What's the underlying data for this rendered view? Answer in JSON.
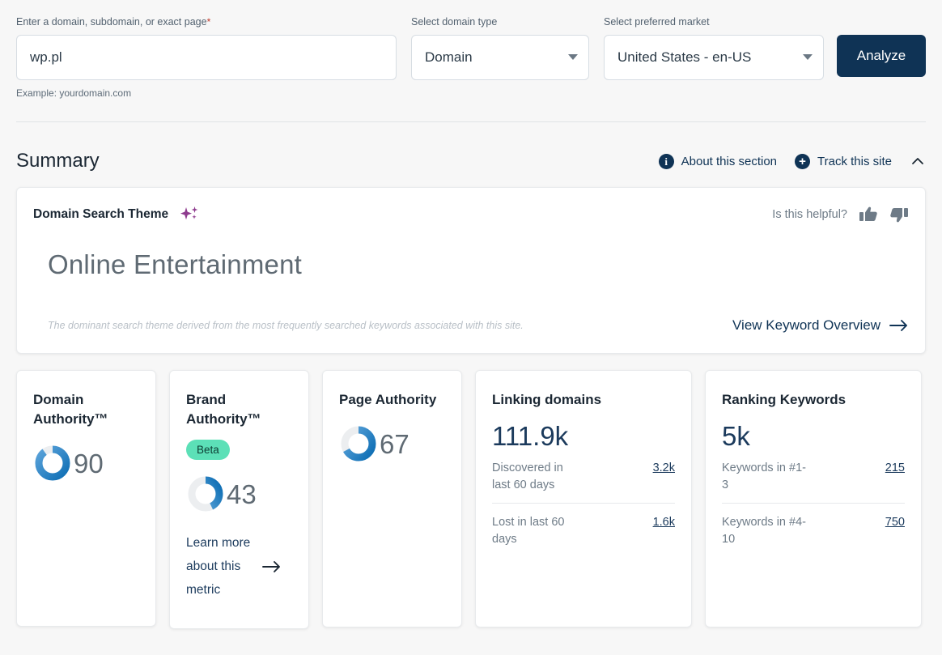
{
  "search": {
    "domain_label": "Enter a domain, subdomain, or exact page",
    "required_mark": "*",
    "domain_value": "wp.pl",
    "domain_placeholder": "yourdomain.com",
    "helper": "Example: yourdomain.com",
    "type_label": "Select domain type",
    "type_value": "Domain",
    "market_label": "Select preferred market",
    "market_value": "United States - en-US",
    "analyze_label": "Analyze"
  },
  "summary": {
    "title": "Summary",
    "about_label": "About this section",
    "track_label": "Track this site",
    "about_icon": "info-circle-icon",
    "track_icon": "plus-circle-icon",
    "collapse_icon": "chevron-up-icon"
  },
  "theme": {
    "kicker": "Domain Search Theme",
    "sparkle_icon": "ai-sparkle-icon",
    "helpful_question": "Is this helpful?",
    "thumbs_up_icon": "thumbs-up-icon",
    "thumbs_down_icon": "thumbs-down-icon",
    "title": "Online Entertainment",
    "note": "The dominant search theme derived from the most frequently searched keywords associated with this site.",
    "link_label": "View Keyword Overview",
    "link_arrow_icon": "arrow-right-icon"
  },
  "metrics": {
    "domain_authority": {
      "title": "Domain Authority™",
      "value": "90",
      "percent": 90
    },
    "brand_authority": {
      "title": "Brand Authority™",
      "badge": "Beta",
      "value": "43",
      "percent": 43,
      "learn_more": "Learn more about this metric",
      "learn_arrow_icon": "arrow-right-icon"
    },
    "page_authority": {
      "title": "Page Authority",
      "value": "67",
      "percent": 67
    },
    "linking_domains": {
      "title": "Linking domains",
      "value": "111.9k",
      "rows": [
        {
          "label": "Discovered in last 60 days",
          "value": "3.2k"
        },
        {
          "label": "Lost in last 60 days",
          "value": "1.6k"
        }
      ]
    },
    "ranking_keywords": {
      "title": "Ranking Keywords",
      "value": "5k",
      "rows": [
        {
          "label": "Keywords in #1-3",
          "value": "215"
        },
        {
          "label": "Keywords in #4-10",
          "value": "750"
        }
      ]
    }
  },
  "colors": {
    "brand_navy": "#0f3355",
    "donut_blue_light": "#5ba3da",
    "donut_blue_dark": "#0f6fb5",
    "donut_track": "#eceef0",
    "beta_teal": "#5ce0b7",
    "sparkle_purple": "#8e3b8e",
    "page_bg": "#f7f7f7"
  }
}
